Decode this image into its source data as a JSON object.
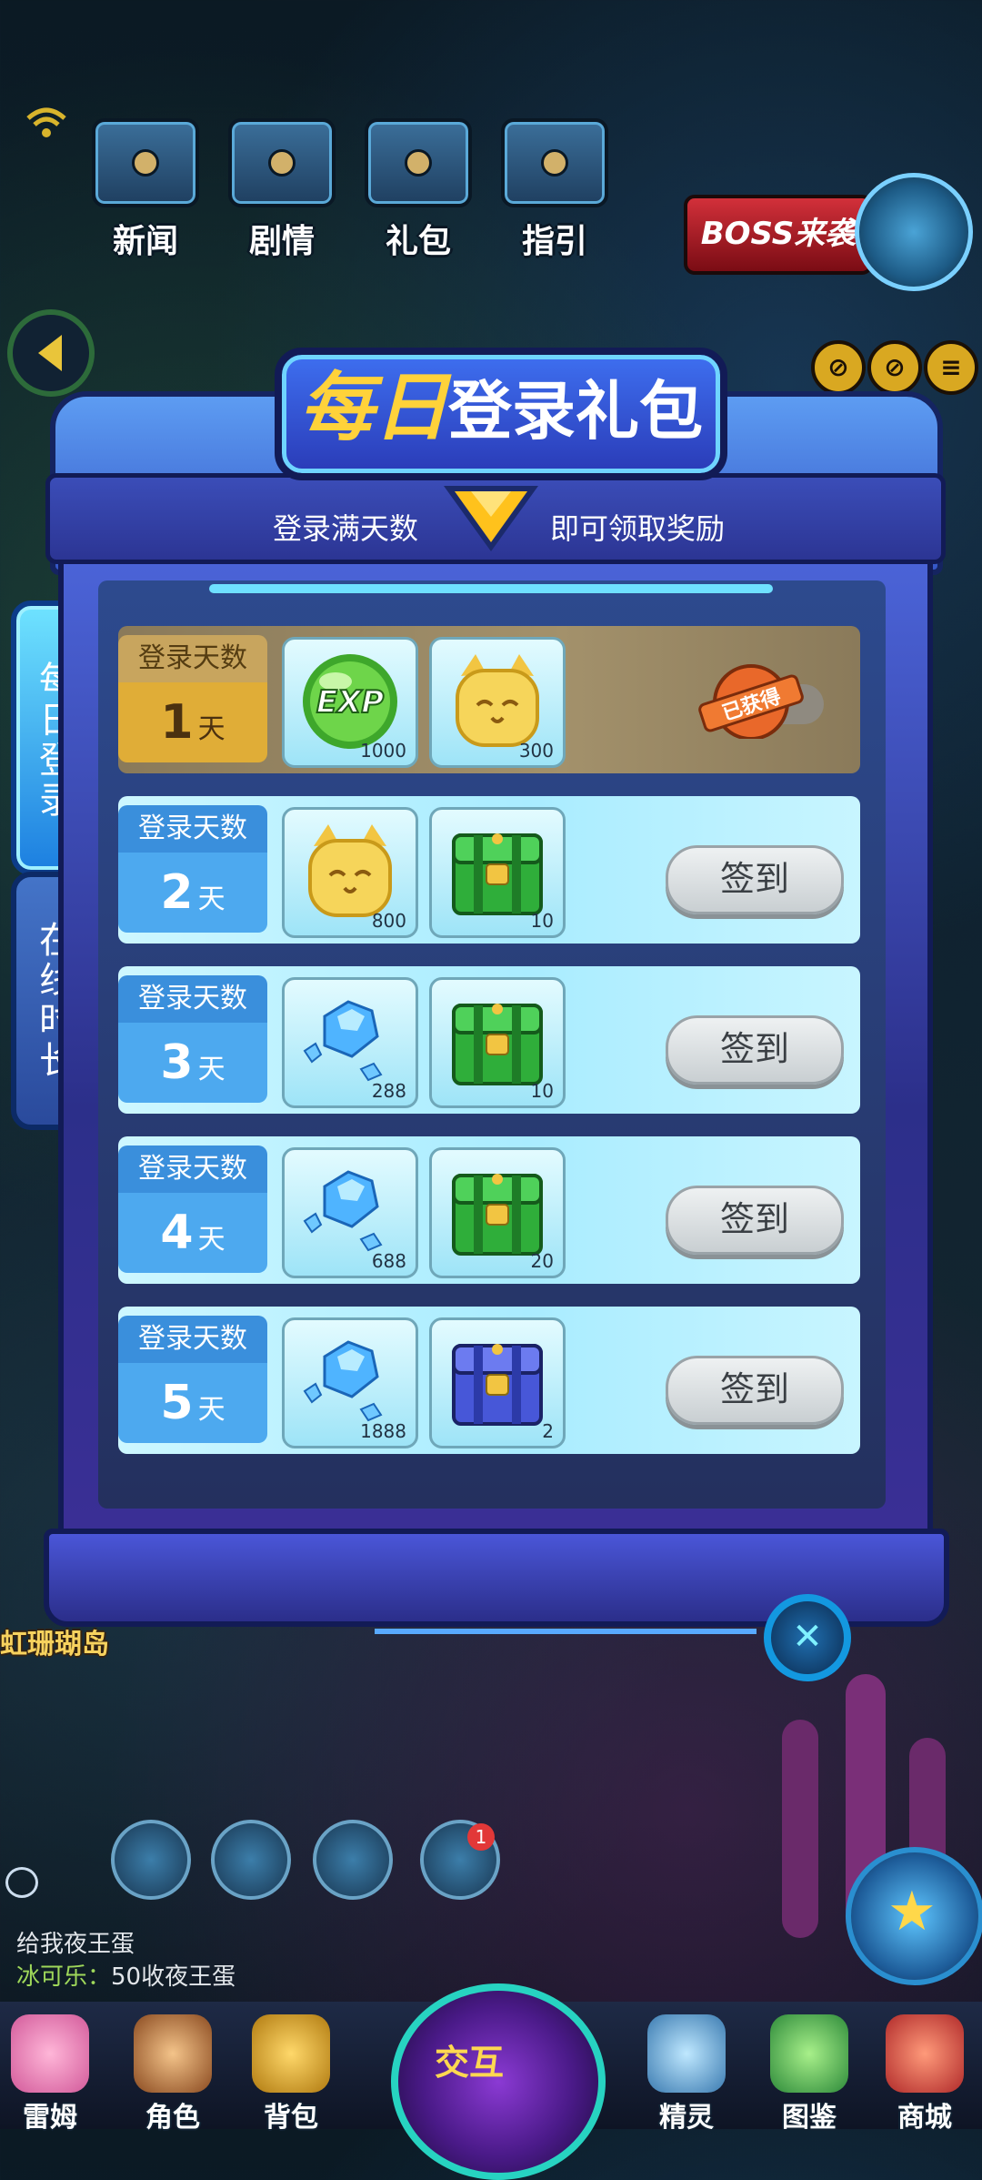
{
  "top_nav": {
    "items": [
      "新闻",
      "剧情",
      "礼包",
      "指引"
    ],
    "boss": "BOSS来袭"
  },
  "side_tabs": {
    "daily": [
      "每",
      "日",
      "登",
      "录"
    ],
    "online": [
      "在",
      "线",
      "时",
      "长"
    ]
  },
  "panel": {
    "title_a": "每日",
    "title_b": "登录礼包",
    "sub_left": "登录满天数",
    "sub_right": "即可领取奖励",
    "close_icon": "close-icon"
  },
  "rows": [
    {
      "header": "登录天数",
      "day": "1",
      "unit": "天",
      "status": "claimed",
      "status_label": "已获得",
      "rewards": [
        {
          "icon": "exp-orb",
          "qty": "1000"
        },
        {
          "icon": "cat-coin",
          "qty": "300"
        }
      ]
    },
    {
      "header": "登录天数",
      "day": "2",
      "unit": "天",
      "status": "open",
      "button": "签到",
      "rewards": [
        {
          "icon": "cat-coin",
          "qty": "800"
        },
        {
          "icon": "green-chest",
          "qty": "10"
        }
      ]
    },
    {
      "header": "登录天数",
      "day": "3",
      "unit": "天",
      "status": "open",
      "button": "签到",
      "rewards": [
        {
          "icon": "blue-crystal",
          "qty": "288"
        },
        {
          "icon": "green-chest",
          "qty": "10"
        }
      ]
    },
    {
      "header": "登录天数",
      "day": "4",
      "unit": "天",
      "status": "open",
      "button": "签到",
      "rewards": [
        {
          "icon": "blue-crystal",
          "qty": "688"
        },
        {
          "icon": "green-chest",
          "qty": "20"
        }
      ]
    },
    {
      "header": "登录天数",
      "day": "5",
      "unit": "天",
      "status": "open",
      "button": "签到",
      "rewards": [
        {
          "icon": "blue-crystal",
          "qty": "1888"
        },
        {
          "icon": "blue-chest",
          "qty": "2"
        }
      ]
    }
  ],
  "map_name": "虹珊瑚岛",
  "badge_count": "1",
  "chat": {
    "line1": "给我夜王蛋",
    "line2_name": "冰可乐：",
    "line2_text": "50收夜王蛋"
  },
  "bottom_nav": {
    "left": [
      "雷姆",
      "角色",
      "背包"
    ],
    "center": "交互",
    "right": [
      "精灵",
      "图鉴",
      "商城"
    ]
  },
  "colors": {
    "gold": "#ffd23a",
    "panel_blue": "#3557c8",
    "row_open": "#a9ecff",
    "row_claimed": "#a3916b",
    "stamp_orange": "#e9682a"
  }
}
